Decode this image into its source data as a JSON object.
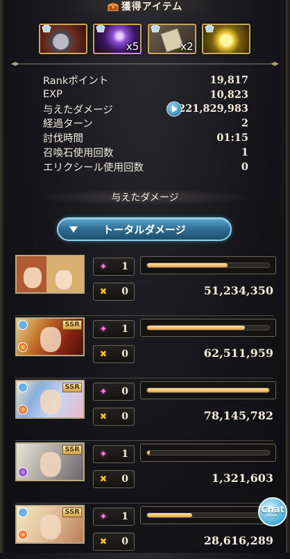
{
  "header": {
    "title": "獲得アイテム"
  },
  "items": [
    {
      "name": "dragon-orb-icon",
      "qty": ""
    },
    {
      "name": "purple-claw-icon",
      "qty": "x5"
    },
    {
      "name": "scroll-icon",
      "qty": "x2"
    },
    {
      "name": "gold-orb-icon",
      "qty": ""
    }
  ],
  "stats": [
    {
      "label": "Rankポイント",
      "value": "19,817"
    },
    {
      "label": "EXP",
      "value": "10,823"
    },
    {
      "label": "与えたダメージ",
      "value": "221,829,983"
    },
    {
      "label": "経過ターン",
      "value": "2"
    },
    {
      "label": "討伐時間",
      "value": "01:15"
    },
    {
      "label": "召喚石使用回数",
      "value": "1"
    },
    {
      "label": "エリクシール使用回数",
      "value": "0"
    }
  ],
  "damage_section": {
    "title": "与えたダメージ",
    "button_label": "トータルダメージ"
  },
  "members": [
    {
      "ssr": "",
      "stat1": "1",
      "stat2": "0",
      "damage": "51,234,350",
      "bar_fraction": 0.66
    },
    {
      "ssr": "SSR",
      "stat1": "1",
      "stat2": "0",
      "damage": "62,511,959",
      "bar_fraction": 0.8
    },
    {
      "ssr": "SSR",
      "stat1": "0",
      "stat2": "0",
      "damage": "78,145,782",
      "bar_fraction": 1.0
    },
    {
      "ssr": "SSR",
      "stat1": "1",
      "stat2": "0",
      "damage": "1,321,603",
      "bar_fraction": 0.02
    },
    {
      "ssr": "SSR",
      "stat1": "1",
      "stat2": "0",
      "damage": "28,616,289",
      "bar_fraction": 0.37
    }
  ],
  "chat": {
    "label": "Chat",
    "dots": "•••"
  },
  "colors": {
    "accent_blue": "#5aa4cc",
    "bar_gold": "#e6a040",
    "frame_gold": "#c9a85c"
  }
}
